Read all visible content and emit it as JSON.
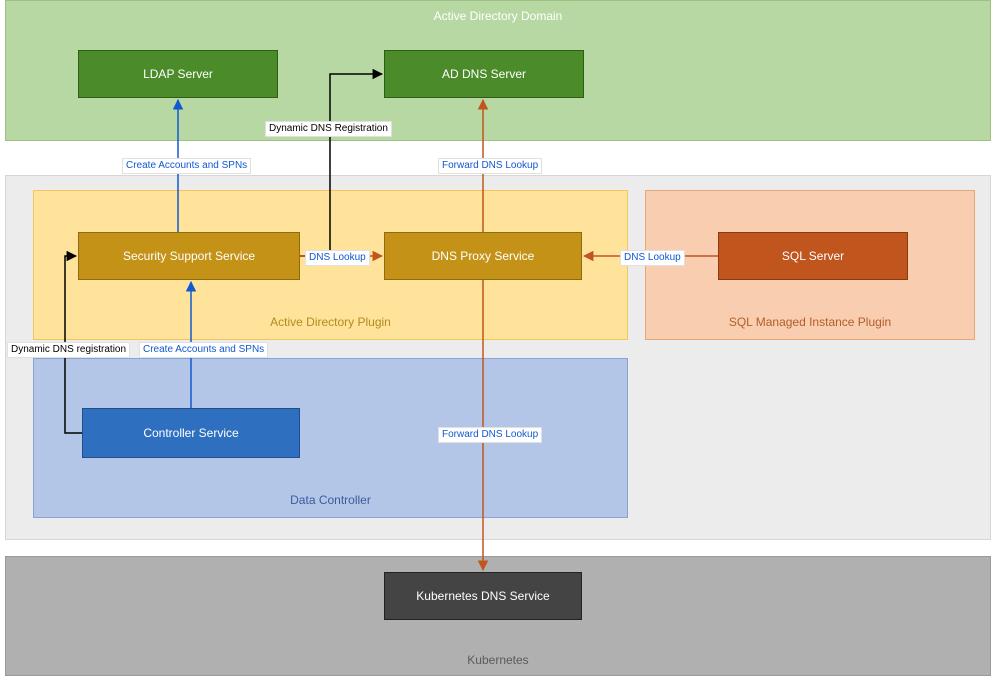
{
  "zones": {
    "ad_domain": {
      "title": "Active Directory Domain"
    },
    "ad_plugin": {
      "title": "Active Directory Plugin"
    },
    "sql_plugin": {
      "title": "SQL Managed Instance Plugin"
    },
    "data_controller": {
      "title": "Data Controller"
    },
    "kubernetes": {
      "title": "Kubernetes"
    }
  },
  "nodes": {
    "ldap_server": {
      "label": "LDAP Server"
    },
    "ad_dns_server": {
      "label": "AD DNS Server"
    },
    "security_support": {
      "label": "Security Support Service"
    },
    "dns_proxy": {
      "label": "DNS Proxy Service"
    },
    "sql_server": {
      "label": "SQL Server"
    },
    "controller_service": {
      "label": "Controller Service"
    },
    "k8s_dns": {
      "label": "Kubernetes DNS Service"
    }
  },
  "edges": {
    "controller_to_security_spns": {
      "label": "Create Accounts and SPNs"
    },
    "security_to_ldap_spns": {
      "label": "Create Accounts and SPNs"
    },
    "dyn_dns_reg_to_addns": {
      "label": "Dynamic DNS Registration"
    },
    "controller_to_security_ddns": {
      "label": "Dynamic DNS registration"
    },
    "security_to_proxy_lookup": {
      "label": "DNS Lookup"
    },
    "sql_to_proxy_lookup": {
      "label": "DNS Lookup"
    },
    "proxy_to_addns_forward": {
      "label": "Forward DNS Lookup"
    },
    "proxy_to_k8s_forward": {
      "label": "Forward DNS Lookup"
    }
  },
  "colors": {
    "ad_domain_bg": "#b7d8a3",
    "ad_domain_border": "#9cc183",
    "ad_domain_title": "#ffffff",
    "middle_bg": "#ececec",
    "middle_border": "#d6d6d6",
    "ad_plugin_bg": "#ffe39b",
    "ad_plugin_border": "#f2c561",
    "ad_plugin_title": "#b58a1e",
    "sql_plugin_bg": "#f8cdb0",
    "sql_plugin_border": "#e9a675",
    "sql_plugin_title": "#b35e28",
    "dc_bg": "#b3c6e7",
    "dc_border": "#8aa3d3",
    "dc_title": "#3d5a9c",
    "k8s_bg": "#b0b0b0",
    "k8s_border": "#9a9a9a",
    "k8s_title": "#5a5a5a",
    "green_node_bg": "#4b8b2a",
    "green_node_border": "#2f5d15",
    "gold_node_bg": "#c49217",
    "gold_node_border": "#8e6a10",
    "orange_node_bg": "#c0561e",
    "orange_node_border": "#8a3b12",
    "blue_node_bg": "#2f6fc0",
    "blue_node_border": "#1f4e8a",
    "dark_node_bg": "#444444",
    "dark_node_border": "#222222",
    "blue_arrow": "#1158d1",
    "orange_arrow": "#c0561e",
    "black_arrow": "#000000"
  },
  "chart_data": {
    "type": "diagram",
    "title": "Active Directory integration architecture",
    "groups": [
      {
        "id": "ad_domain",
        "label": "Active Directory Domain",
        "children": [
          "ldap_server",
          "ad_dns_server"
        ]
      },
      {
        "id": "ad_plugin",
        "label": "Active Directory Plugin",
        "parent": "data_controller",
        "children": [
          "security_support",
          "dns_proxy"
        ]
      },
      {
        "id": "sql_plugin",
        "label": "SQL Managed Instance Plugin",
        "children": [
          "sql_server"
        ]
      },
      {
        "id": "data_controller",
        "label": "Data Controller",
        "children": [
          "ad_plugin",
          "controller_service"
        ]
      },
      {
        "id": "kubernetes",
        "label": "Kubernetes",
        "children": [
          "k8s_dns"
        ]
      }
    ],
    "nodes": [
      {
        "id": "ldap_server",
        "label": "LDAP Server"
      },
      {
        "id": "ad_dns_server",
        "label": "AD DNS Server"
      },
      {
        "id": "security_support",
        "label": "Security Support Service"
      },
      {
        "id": "dns_proxy",
        "label": "DNS Proxy Service"
      },
      {
        "id": "sql_server",
        "label": "SQL Server"
      },
      {
        "id": "controller_service",
        "label": "Controller Service"
      },
      {
        "id": "k8s_dns",
        "label": "Kubernetes DNS Service"
      }
    ],
    "edges": [
      {
        "from": "controller_service",
        "to": "security_support",
        "label": "Create Accounts and SPNs",
        "color": "blue"
      },
      {
        "from": "security_support",
        "to": "ldap_server",
        "label": "Create Accounts and SPNs",
        "color": "blue"
      },
      {
        "from": "security_support",
        "to": "ad_dns_server",
        "label": "Dynamic DNS Registration",
        "color": "black",
        "via": "orthogonal"
      },
      {
        "from": "controller_service",
        "to": "security_support",
        "label": "Dynamic DNS registration",
        "color": "black",
        "via": "orthogonal"
      },
      {
        "from": "security_support",
        "to": "dns_proxy",
        "label": "DNS Lookup",
        "color": "orange"
      },
      {
        "from": "sql_server",
        "to": "dns_proxy",
        "label": "DNS Lookup",
        "color": "orange"
      },
      {
        "from": "dns_proxy",
        "to": "ad_dns_server",
        "label": "Forward DNS Lookup",
        "color": "orange"
      },
      {
        "from": "dns_proxy",
        "to": "k8s_dns",
        "label": "Forward DNS Lookup",
        "color": "orange"
      }
    ]
  }
}
